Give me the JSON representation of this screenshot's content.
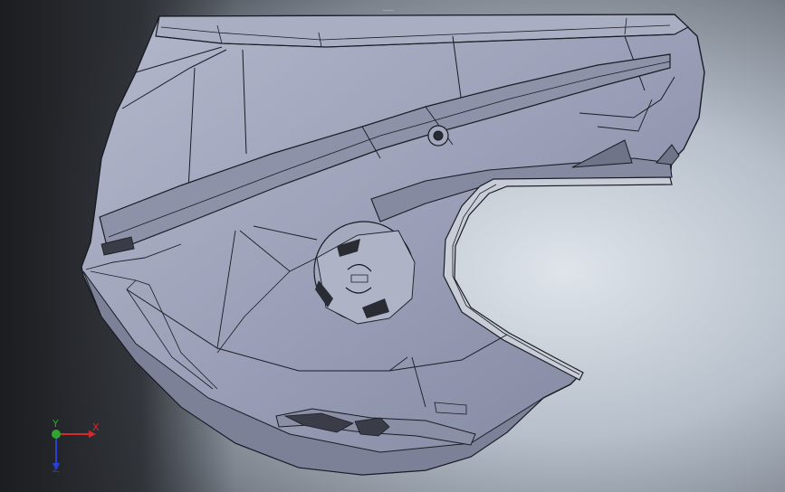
{
  "viewport": {
    "background_top": "#e8ebef",
    "background_mid": "#b9c2cc",
    "background_dark": "#1b1d20",
    "model_fill": "#9a9fb7",
    "model_edge": "#1a1c24"
  },
  "triad": {
    "x_label": "X",
    "y_label": "Y",
    "z_label": "Z",
    "x_color": "#d42a2a",
    "y_color": "#2fa52f",
    "z_color": "#2a3fd4"
  }
}
